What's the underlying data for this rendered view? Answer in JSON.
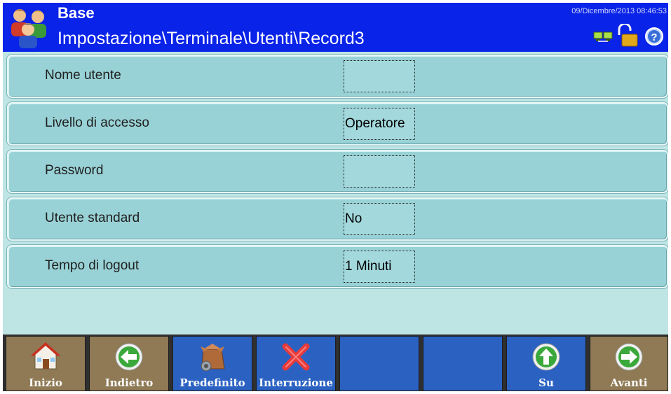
{
  "header": {
    "title": "Base",
    "path": "Impostazione\\Terminale\\Utenti\\Record3",
    "datetime": "09/Dicembre/2013 08:46:53",
    "icons": [
      "users-group-icon",
      "network-icon",
      "padlock-open-icon",
      "help-icon"
    ]
  },
  "rows": [
    {
      "label": "Nome utente",
      "value": ""
    },
    {
      "label": "Livello di accesso",
      "value": "Operatore"
    },
    {
      "label": "Password",
      "value": ""
    },
    {
      "label": "Utente standard",
      "value": "No"
    },
    {
      "label": "Tempo di logout",
      "value": "1 Minuti"
    }
  ],
  "toolbar": {
    "buttons": [
      {
        "label": "Inizio",
        "icon": "home-icon",
        "color": "#8f7a55"
      },
      {
        "label": "Indietro",
        "icon": "arrow-left-icon",
        "color": "#8f7a55"
      },
      {
        "label": "Predefinito",
        "icon": "default-box-gear-icon",
        "color": "#2b62c2"
      },
      {
        "label": "Interruzione",
        "icon": "cancel-x-icon",
        "color": "#2b62c2"
      },
      {
        "label": "",
        "icon": "",
        "color": "#2b62c2"
      },
      {
        "label": "",
        "icon": "",
        "color": "#2b62c2"
      },
      {
        "label": "Su",
        "icon": "arrow-up-icon",
        "color": "#2b62c2"
      },
      {
        "label": "Avanti",
        "icon": "arrow-right-icon",
        "color": "#8f7a55"
      }
    ]
  },
  "colors": {
    "header_bg": "#0a23e8",
    "row_bg": "#99d2d6",
    "screen_bg": "#bfe4e4",
    "toolbar_brown": "#8f7a55",
    "toolbar_blue": "#2b62c2"
  }
}
